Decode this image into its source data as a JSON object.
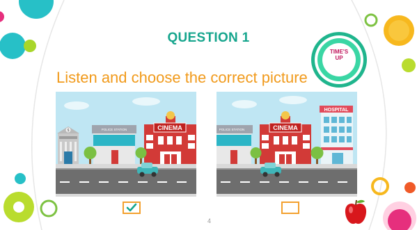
{
  "slide": {
    "title": "QUESTION 1",
    "prompt": "Listen and choose the correct picture",
    "timer_label_1": "TIME'S",
    "timer_label_2": "UP",
    "page_number": "4"
  },
  "pictures": [
    {
      "signs": {
        "bank": "$",
        "police": "POLICE STATION",
        "cinema": "CINEMA"
      }
    },
    {
      "signs": {
        "police": "POLICE STATION",
        "cinema": "CINEMA",
        "hospital": "HOSPITAL"
      }
    }
  ],
  "choices": [
    {
      "checked": true
    },
    {
      "checked": false
    }
  ],
  "colors": {
    "title": "#16a58d",
    "prompt": "#f19a1b",
    "checkbox": "#f3a02d",
    "check": "#16a58d",
    "timer_ring": "#2bd3a0",
    "timer_text": "#c0185e"
  },
  "icons": [
    "checkmark-icon",
    "apple-icon",
    "timer-icon"
  ]
}
